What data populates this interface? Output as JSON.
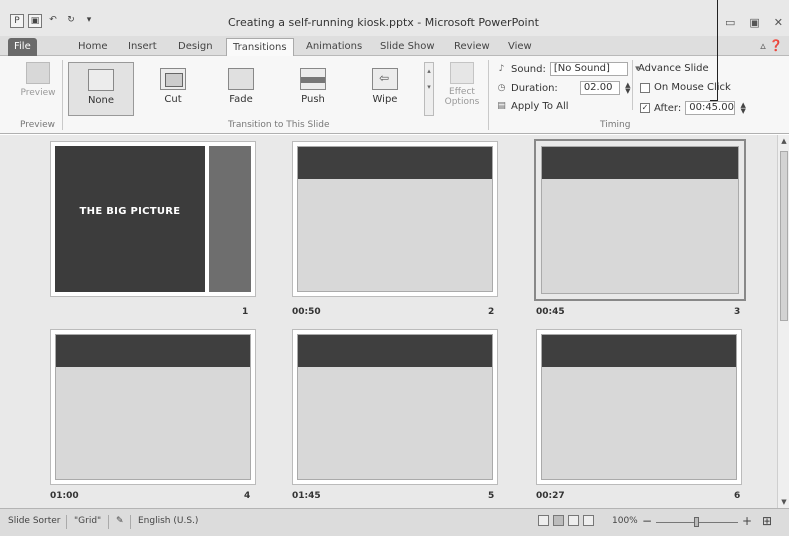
{
  "window": {
    "title": "Creating a self-running kiosk.pptx - Microsoft PowerPoint",
    "controls": [
      "▭",
      "▣",
      "✕"
    ]
  },
  "qat": [
    "P",
    "▣",
    "↶",
    "↻",
    "▾"
  ],
  "tabs": [
    "File",
    "Home",
    "Insert",
    "Design",
    "Transitions",
    "Animations",
    "Slide Show",
    "Review",
    "View"
  ],
  "help": "▵ ❓",
  "ribbon": {
    "preview_label": "Preview",
    "preview_group": "Preview",
    "gallery_items": [
      "None",
      "Cut",
      "Fade",
      "Push",
      "Wipe"
    ],
    "gallery_group": "Transition to This Slide",
    "effect_options": "Effect Options",
    "sound_label": "Sound:",
    "sound_value": "[No Sound]",
    "duration_label": "Duration:",
    "duration_value": "02.00",
    "apply_all": "Apply To All",
    "advance_label": "Advance Slide",
    "on_mouse_click": "On Mouse Click",
    "after_label": "After:",
    "after_value": "00:45.00",
    "after_checked": true,
    "mouse_click_checked": false,
    "timing_group": "Timing"
  },
  "slides": [
    {
      "number": "1",
      "time": "",
      "title": "THE BIG PICTURE",
      "selected": false
    },
    {
      "number": "2",
      "time": "00:50",
      "title": "",
      "selected": false
    },
    {
      "number": "3",
      "time": "00:45",
      "title": "",
      "selected": true
    },
    {
      "number": "4",
      "time": "01:00",
      "title": "",
      "selected": false
    },
    {
      "number": "5",
      "time": "01:45",
      "title": "",
      "selected": false
    },
    {
      "number": "6",
      "time": "00:27",
      "title": "",
      "selected": false
    }
  ],
  "status": {
    "view": "Slide Sorter",
    "theme": "\"Grid\"",
    "language": "English (U.S.)",
    "zoom": "100%",
    "zoom_minus": "−",
    "zoom_plus": "+"
  }
}
